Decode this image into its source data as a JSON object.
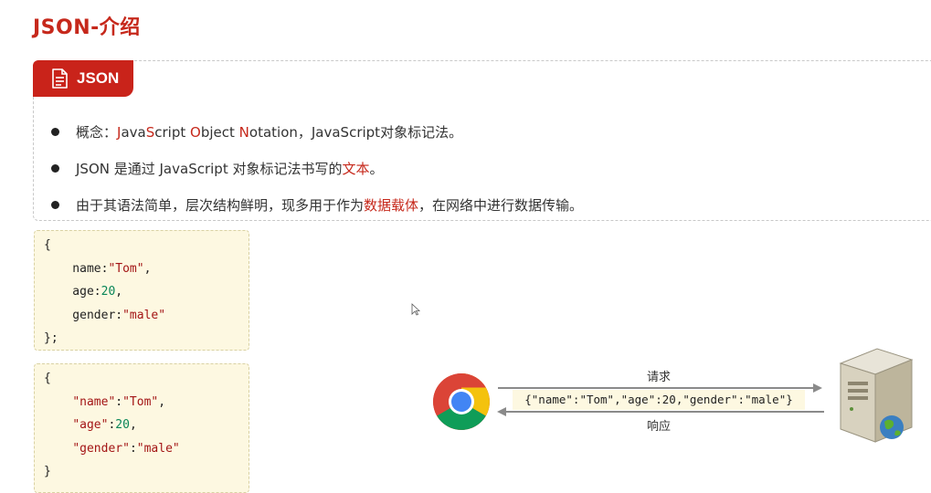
{
  "page": {
    "title": "JSON-介绍"
  },
  "card": {
    "tag_label": "JSON",
    "bullets": [
      {
        "parts": [
          {
            "text": "概念：",
            "red": false
          },
          {
            "text": "J",
            "red": true
          },
          {
            "text": "ava",
            "red": false
          },
          {
            "text": "S",
            "red": true
          },
          {
            "text": "cript ",
            "red": false
          },
          {
            "text": "O",
            "red": true
          },
          {
            "text": "bject ",
            "red": false
          },
          {
            "text": "N",
            "red": true
          },
          {
            "text": "otation，JavaScript对象标记法。",
            "red": false
          }
        ]
      },
      {
        "parts": [
          {
            "text": "JSON 是通过 JavaScript 对象标记法书写的",
            "red": false
          },
          {
            "text": "文本",
            "red": true
          },
          {
            "text": "。",
            "red": false
          }
        ]
      },
      {
        "parts": [
          {
            "text": "由于其语法简单，层次结构鲜明，现多用于作为",
            "red": false
          },
          {
            "text": "数据载体",
            "red": true
          },
          {
            "text": "，在网络中进行数据传输。",
            "red": false
          }
        ]
      }
    ]
  },
  "code1": {
    "lines": [
      [
        {
          "t": "{",
          "c": ""
        }
      ],
      [
        {
          "t": "    name:",
          "c": ""
        },
        {
          "t": "\"Tom\"",
          "c": "str"
        },
        {
          "t": ",",
          "c": ""
        }
      ],
      [
        {
          "t": "    age:",
          "c": ""
        },
        {
          "t": "20",
          "c": "num"
        },
        {
          "t": ",",
          "c": ""
        }
      ],
      [
        {
          "t": "    gender:",
          "c": ""
        },
        {
          "t": "\"male\"",
          "c": "str"
        }
      ],
      [
        {
          "t": "};",
          "c": ""
        }
      ]
    ]
  },
  "code2": {
    "lines": [
      [
        {
          "t": "{",
          "c": ""
        }
      ],
      [
        {
          "t": "    ",
          "c": ""
        },
        {
          "t": "\"name\"",
          "c": "str"
        },
        {
          "t": ":",
          "c": ""
        },
        {
          "t": "\"Tom\"",
          "c": "str"
        },
        {
          "t": ",",
          "c": ""
        }
      ],
      [
        {
          "t": "    ",
          "c": ""
        },
        {
          "t": "\"age\"",
          "c": "str"
        },
        {
          "t": ":",
          "c": ""
        },
        {
          "t": "20",
          "c": "num"
        },
        {
          "t": ",",
          "c": ""
        }
      ],
      [
        {
          "t": "    ",
          "c": ""
        },
        {
          "t": "\"gender\"",
          "c": "str"
        },
        {
          "t": ":",
          "c": ""
        },
        {
          "t": "\"male\"",
          "c": "str"
        }
      ],
      [
        {
          "t": "}",
          "c": ""
        }
      ]
    ]
  },
  "diagram": {
    "request_label": "请求",
    "response_label": "响应",
    "payload": "{\"name\":\"Tom\",\"age\":20,\"gender\":\"male\"}",
    "browser_icon": "chrome-icon",
    "server_icon": "server-icon"
  },
  "colors": {
    "accent_red": "#c6281b",
    "code_bg": "#fdf8e1"
  }
}
